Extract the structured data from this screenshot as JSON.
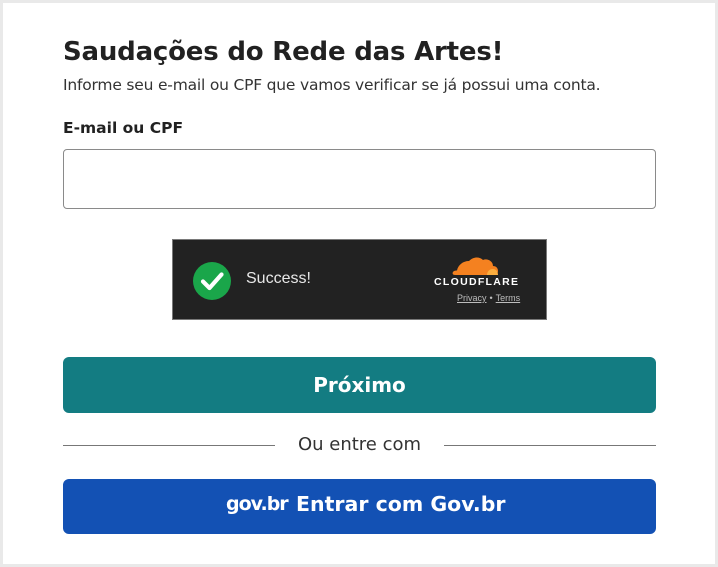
{
  "header": {
    "title": "Saudações do Rede das Artes!",
    "subtitle": "Informe seu e-mail ou CPF que vamos verificar se já possui uma conta."
  },
  "form": {
    "email_label": "E-mail ou CPF",
    "email_value": "",
    "email_placeholder": ""
  },
  "captcha": {
    "status_text": "Success!",
    "status_icon": "check-circle-icon",
    "brand": "CLOUDFLARE",
    "privacy_link": "Privacy",
    "separator": "•",
    "terms_link": "Terms",
    "colors": {
      "background": "#222222",
      "check": "#1aa64a",
      "brand_orange": "#f48120"
    }
  },
  "actions": {
    "next_label": "Próximo",
    "divider_text": "Ou entre com",
    "govbr_logo": "gov.br",
    "govbr_label": "Entrar com Gov.br"
  },
  "colors": {
    "primary": "#137c82",
    "govbr_blue": "#1351b4"
  }
}
